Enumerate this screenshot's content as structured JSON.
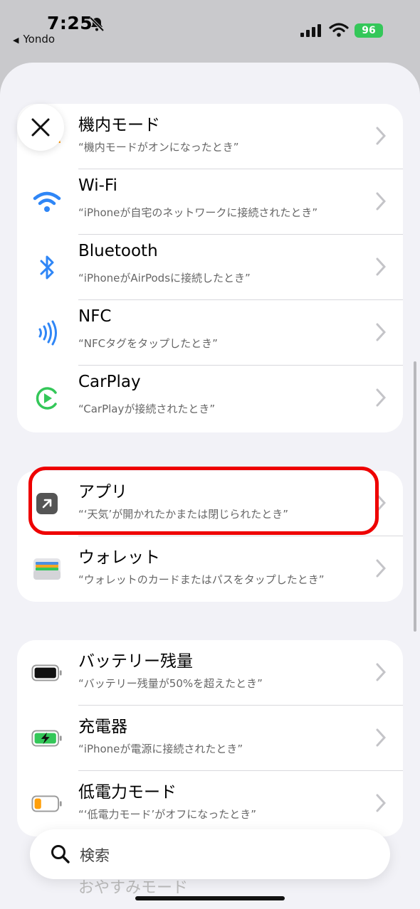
{
  "status": {
    "time": "7:25",
    "back_app": "Yondo",
    "battery": "96"
  },
  "groups": [
    {
      "rows": [
        {
          "title": "機内モード",
          "sub": "“機内モードがオンになったとき”",
          "icon": "airplane-icon"
        },
        {
          "title": "Wi-Fi",
          "sub": "“iPhoneが自宅のネットワークに接続されたとき”",
          "icon": "wifi-icon"
        },
        {
          "title": "Bluetooth",
          "sub": "“iPhoneがAirPodsに接続したとき”",
          "icon": "bluetooth-icon"
        },
        {
          "title": "NFC",
          "sub": "“NFCタグをタップしたとき”",
          "icon": "nfc-icon"
        },
        {
          "title": "CarPlay",
          "sub": "“CarPlayが接続されたとき”",
          "icon": "carplay-icon"
        }
      ]
    },
    {
      "rows": [
        {
          "title": "アプリ",
          "sub": "“‘天気’が開かれたかまたは閉じられたとき”",
          "icon": "app-arrow-icon"
        },
        {
          "title": "ウォレット",
          "sub": "“ウォレットのカードまたはパスをタップしたとき”",
          "icon": "wallet-icon"
        }
      ]
    },
    {
      "rows": [
        {
          "title": "バッテリー残量",
          "sub": "“バッテリー残量が50%を超えたとき”",
          "icon": "battery-full-icon"
        },
        {
          "title": "充電器",
          "sub": "“iPhoneが電源に接続されたとき”",
          "icon": "battery-charging-icon"
        },
        {
          "title": "低電力モード",
          "sub": "“‘低電力モード’がオフになったとき”",
          "icon": "battery-low-icon"
        }
      ]
    }
  ],
  "search": {
    "placeholder": "検索"
  },
  "peek_row": "おやすみモード",
  "colors": {
    "accent_blue": "#2f86f6",
    "orange": "#ff9500",
    "green": "#34c759",
    "highlight_red": "#ee0000"
  }
}
